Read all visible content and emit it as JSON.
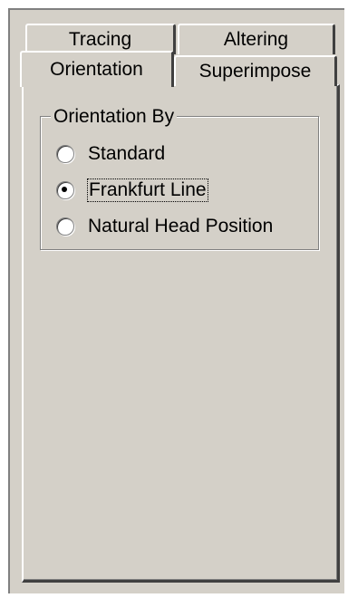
{
  "tabs": {
    "row_back": [
      "Tracing",
      "Altering"
    ],
    "row_front": [
      "Orientation",
      "Superimpose"
    ],
    "active": "Orientation"
  },
  "group": {
    "title": "Orientation By",
    "options": [
      {
        "label": "Standard",
        "selected": false
      },
      {
        "label": "Frankfurt Line",
        "selected": true,
        "focused": true
      },
      {
        "label": "Natural Head Position",
        "selected": false
      }
    ]
  },
  "colors": {
    "face": "#d4d0c8",
    "highlight": "#ffffff",
    "shadow": "#808080",
    "dark_shadow": "#404040"
  }
}
